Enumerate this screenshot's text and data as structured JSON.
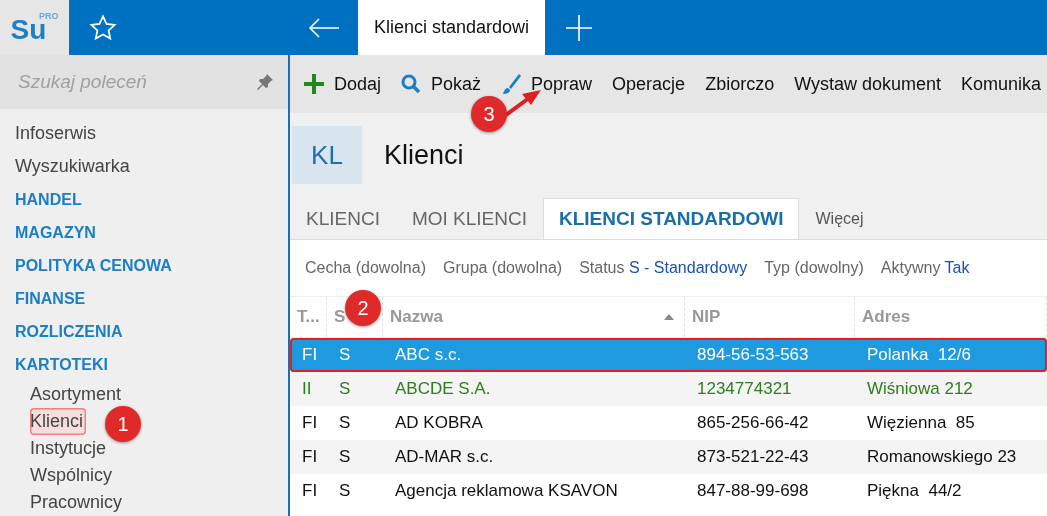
{
  "logo": {
    "text": "Su",
    "sup": "PRO"
  },
  "top_tabs": [
    {
      "label": "Klienci standardowi",
      "selected": true
    }
  ],
  "sidebar": {
    "search": {
      "placeholder": "Szukaj poleceń"
    },
    "items": [
      {
        "label": "Infoserwis",
        "kind": "link"
      },
      {
        "label": "Wyszukiwarka",
        "kind": "link"
      },
      {
        "label": "HANDEL",
        "kind": "section"
      },
      {
        "label": "MAGAZYN",
        "kind": "section"
      },
      {
        "label": "POLITYKA CENOWA",
        "kind": "section"
      },
      {
        "label": "FINANSE",
        "kind": "section"
      },
      {
        "label": "ROZLICZENIA",
        "kind": "section"
      },
      {
        "label": "KARTOTEKI",
        "kind": "section",
        "children": [
          {
            "label": "Asortyment",
            "selected": false
          },
          {
            "label": "Klienci",
            "selected": true
          },
          {
            "label": "Instytucje",
            "selected": false
          },
          {
            "label": "Wspólnicy",
            "selected": false
          },
          {
            "label": "Pracownicy",
            "selected": false
          }
        ]
      }
    ]
  },
  "toolbar": [
    {
      "label": "Dodaj",
      "kind": "add"
    },
    {
      "label": "Pokaż",
      "kind": "show"
    },
    {
      "label": "Popraw",
      "kind": "edit"
    },
    {
      "label": "Operacje",
      "kind": "plain"
    },
    {
      "label": "Zbiorczo",
      "kind": "plain"
    },
    {
      "label": "Wystaw dokument",
      "kind": "plain"
    },
    {
      "label": "Komunika",
      "kind": "plain"
    }
  ],
  "header": {
    "code": "KL",
    "title": "Klienci"
  },
  "tabs": [
    {
      "label": "KLIENCI",
      "selected": false
    },
    {
      "label": "MOI KLIENCI",
      "selected": false
    },
    {
      "label": "KLIENCI STANDARDOWI",
      "selected": true
    },
    {
      "label": "Więcej",
      "selected": false
    }
  ],
  "filters": [
    {
      "label": "Cecha (dowolna)"
    },
    {
      "label": "Grupa (dowolna)"
    },
    {
      "label": "Status",
      "value": "S - Standardowy"
    },
    {
      "label": "Typ (dowolny)"
    },
    {
      "label": "Aktywny",
      "value": "Tak"
    }
  ],
  "table": {
    "columns": [
      {
        "label": "T...",
        "sorted": false
      },
      {
        "label": "S",
        "sorted": false
      },
      {
        "label": "Nazwa",
        "sorted": true
      },
      {
        "label": "NIP",
        "sorted": false
      },
      {
        "label": "Adres",
        "sorted": false
      }
    ],
    "rows": [
      {
        "cells": [
          "FI",
          "S",
          "ABC s.c.",
          "894-56-53-563",
          "Polanka  12/6"
        ],
        "selected": true
      },
      {
        "cells": [
          "II",
          "S",
          "ABCDE S.A.",
          "1234774321",
          "Wiśniowa 212"
        ],
        "selected": false,
        "kind": "accent"
      },
      {
        "cells": [
          "FI",
          "S",
          "AD KOBRA",
          "865-256-66-42",
          "Więzienna  85"
        ],
        "selected": false,
        "kind": "normal"
      },
      {
        "cells": [
          "FI",
          "S",
          "AD-MAR s.c.",
          "873-521-22-43",
          "Romanowskiego 23"
        ],
        "selected": false,
        "kind": "normal"
      },
      {
        "cells": [
          "FI",
          "S",
          "Agencja reklamowa KSAVON",
          "847-88-99-698",
          "Piękna  44/2"
        ],
        "selected": false,
        "kind": "normal"
      }
    ]
  },
  "callouts": [
    {
      "label": "1"
    },
    {
      "label": "2"
    },
    {
      "label": "3"
    }
  ]
}
